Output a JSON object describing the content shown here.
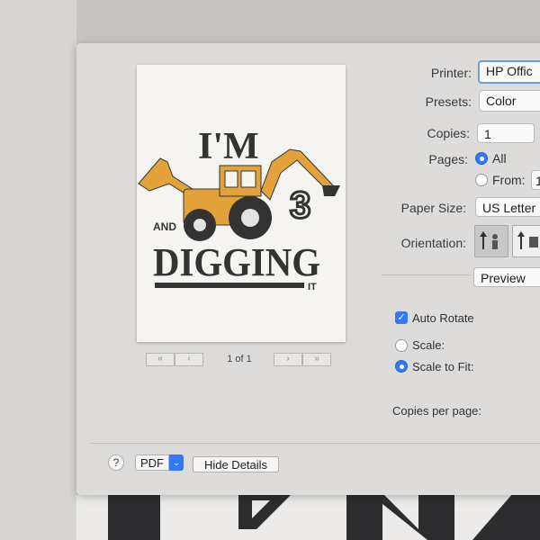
{
  "preview": {
    "artwork_text": [
      "I'M",
      "3",
      "AND",
      "DIGGING",
      "IT"
    ],
    "page_count": "1 of 1",
    "pager_buttons": [
      "«",
      "‹",
      "›",
      "»"
    ]
  },
  "settings": {
    "printer_label": "Printer:",
    "printer_value": "HP Offic",
    "presets_label": "Presets:",
    "presets_value": "Color",
    "copies_label": "Copies:",
    "copies_value": "1",
    "pages_label": "Pages:",
    "pages_all": "All",
    "pages_from": "From:",
    "pages_from_value": "1",
    "paper_size_label": "Paper Size:",
    "paper_size_value": "US Letter",
    "orientation_label": "Orientation:",
    "section_value": "Preview",
    "auto_rotate": "Auto Rotate",
    "scale": "Scale:",
    "scale_to_fit": "Scale to Fit:",
    "copies_per_page": "Copies per page:"
  },
  "footer": {
    "help": "?",
    "pdf": "PDF",
    "pdf_arrow": "⌄",
    "hide_details": "Hide Details"
  },
  "colors": {
    "accent": "#3478f6",
    "art_orange": "#e3a33a",
    "art_dark": "#333333"
  }
}
